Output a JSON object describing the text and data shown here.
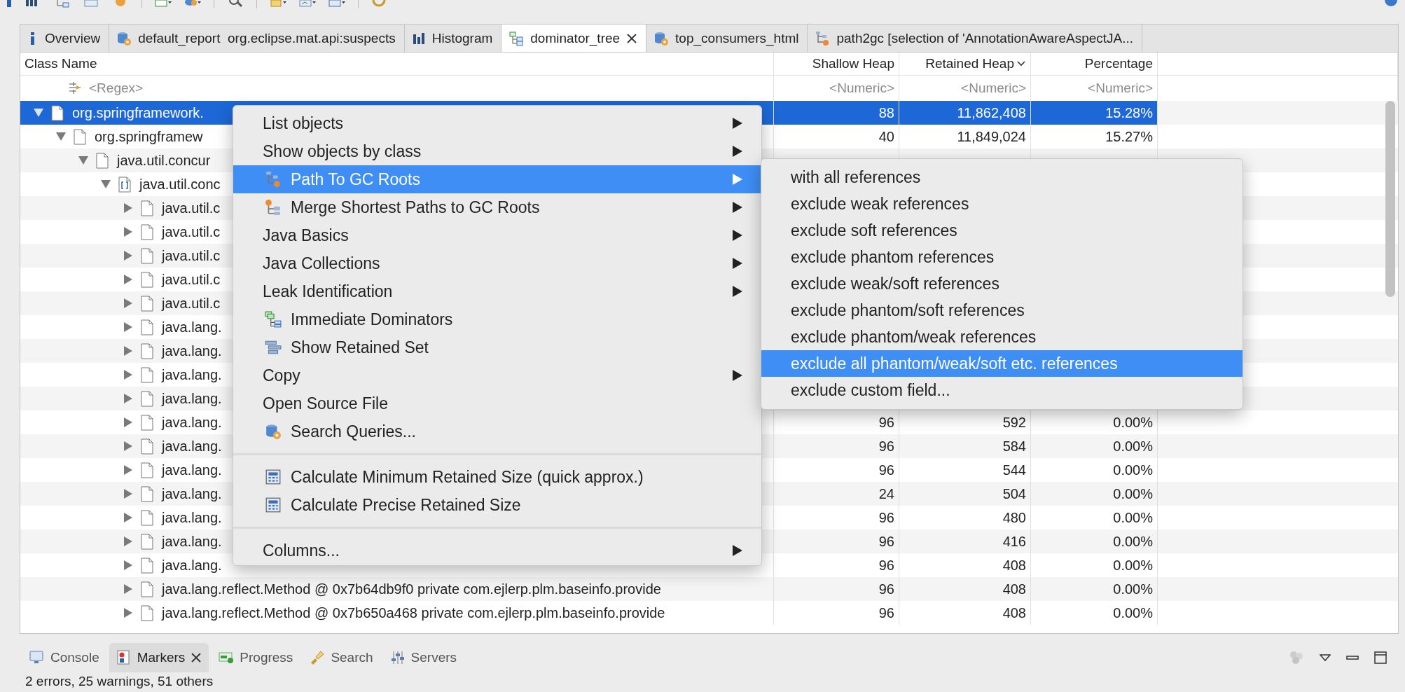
{
  "editor_tabs": [
    {
      "label": "Overview",
      "selected": false,
      "closable": false
    },
    {
      "label": "default_report  org.eclipse.mat.api:suspects",
      "selected": false,
      "closable": false
    },
    {
      "label": "Histogram",
      "selected": false,
      "closable": false
    },
    {
      "label": "dominator_tree",
      "selected": true,
      "closable": true
    },
    {
      "label": "top_consumers_html",
      "selected": false,
      "closable": false
    },
    {
      "label": "path2gc [selection of 'AnnotationAwareAspectJA...",
      "selected": false,
      "closable": false
    }
  ],
  "table": {
    "columns": [
      {
        "label": "Class Name",
        "sorted": false
      },
      {
        "label": "Shallow Heap",
        "sorted": false
      },
      {
        "label": "Retained Heap",
        "sorted": true
      },
      {
        "label": "Percentage",
        "sorted": false
      }
    ],
    "filters": [
      "<Regex>",
      "<Numeric>",
      "<Numeric>",
      "<Numeric>"
    ],
    "rows": [
      {
        "name": "org.springframework.",
        "kind": "object",
        "expanded": true,
        "selected": true,
        "shallow_heap": "88",
        "retained_heap": "11,862,408",
        "percentage": "15.28%",
        "children": [
          {
            "name": "org.springframew",
            "kind": "object",
            "expanded": true,
            "selected": false,
            "shallow_heap": "40",
            "retained_heap": "11,849,024",
            "percentage": "15.27%",
            "children": [
              {
                "name": "java.util.concur",
                "kind": "object",
                "expanded": true,
                "selected": false,
                "children": [
                  {
                    "name": "java.util.conc",
                    "kind": "array",
                    "expanded": true,
                    "selected": false,
                    "children": [
                      {
                        "name": "java.util.c",
                        "kind": "object",
                        "expanded": false,
                        "selected": false
                      },
                      {
                        "name": "java.util.c",
                        "kind": "object",
                        "expanded": false,
                        "selected": false
                      },
                      {
                        "name": "java.util.c",
                        "kind": "object",
                        "expanded": false,
                        "selected": false
                      },
                      {
                        "name": "java.util.c",
                        "kind": "object",
                        "expanded": false,
                        "selected": false
                      },
                      {
                        "name": "java.util.c",
                        "kind": "object",
                        "expanded": false,
                        "selected": false
                      },
                      {
                        "name": "java.lang.",
                        "kind": "object",
                        "expanded": false,
                        "selected": false
                      },
                      {
                        "name": "java.lang.",
                        "kind": "object",
                        "expanded": false,
                        "selected": false
                      },
                      {
                        "name": "java.lang.",
                        "kind": "object",
                        "expanded": false,
                        "selected": false
                      },
                      {
                        "name": "java.lang.",
                        "kind": "object",
                        "expanded": false,
                        "selected": false
                      },
                      {
                        "name": "java.lang.",
                        "kind": "object",
                        "expanded": false,
                        "selected": false,
                        "shallow_heap": "96",
                        "retained_heap": "592",
                        "percentage": "0.00%"
                      },
                      {
                        "name": "java.lang.",
                        "kind": "object",
                        "expanded": false,
                        "selected": false,
                        "shallow_heap": "96",
                        "retained_heap": "584",
                        "percentage": "0.00%"
                      },
                      {
                        "name": "java.lang.",
                        "kind": "object",
                        "expanded": false,
                        "selected": false,
                        "shallow_heap": "96",
                        "retained_heap": "544",
                        "percentage": "0.00%"
                      },
                      {
                        "name": "java.lang.",
                        "kind": "object",
                        "expanded": false,
                        "selected": false,
                        "shallow_heap": "24",
                        "retained_heap": "504",
                        "percentage": "0.00%"
                      },
                      {
                        "name": "java.lang.",
                        "kind": "object",
                        "expanded": false,
                        "selected": false,
                        "shallow_heap": "96",
                        "retained_heap": "480",
                        "percentage": "0.00%"
                      },
                      {
                        "name": "java.lang.",
                        "kind": "object",
                        "expanded": false,
                        "selected": false,
                        "shallow_heap": "96",
                        "retained_heap": "416",
                        "percentage": "0.00%"
                      },
                      {
                        "name": "java.lang.",
                        "kind": "object",
                        "expanded": false,
                        "selected": false,
                        "shallow_heap": "96",
                        "retained_heap": "408",
                        "percentage": "0.00%"
                      },
                      {
                        "name": "java.lang.reflect.Method @ 0x7b64db9f0  private  com.ejlerp.plm.baseinfo.provide",
                        "kind": "object",
                        "expanded": false,
                        "selected": false,
                        "shallow_heap": "96",
                        "retained_heap": "408",
                        "percentage": "0.00%"
                      },
                      {
                        "name": "java.lang.reflect.Method @ 0x7b650a468  private  com.ejlerp.plm.baseinfo.provide",
                        "kind": "object",
                        "expanded": false,
                        "selected": false,
                        "shallow_heap": "96",
                        "retained_heap": "408",
                        "percentage": "0.00%"
                      }
                    ]
                  }
                ]
              }
            ]
          }
        ]
      }
    ]
  },
  "context_menu": {
    "items": [
      {
        "kind": "item",
        "label": "List objects",
        "has_submenu": true,
        "selected": false
      },
      {
        "kind": "item",
        "label": "Show objects by class",
        "has_submenu": true,
        "selected": false
      },
      {
        "kind": "item",
        "label": "Path To GC Roots",
        "has_submenu": true,
        "selected": true
      },
      {
        "kind": "item",
        "label": "Merge Shortest Paths to GC Roots",
        "has_submenu": true,
        "selected": false
      },
      {
        "kind": "item",
        "label": "Java Basics",
        "has_submenu": true,
        "selected": false
      },
      {
        "kind": "item",
        "label": "Java Collections",
        "has_submenu": true,
        "selected": false
      },
      {
        "kind": "item",
        "label": "Leak Identification",
        "has_submenu": true,
        "selected": false
      },
      {
        "kind": "item",
        "label": "Immediate Dominators",
        "has_submenu": false,
        "selected": false
      },
      {
        "kind": "item",
        "label": "Show Retained Set",
        "has_submenu": false,
        "selected": false
      },
      {
        "kind": "item",
        "label": "Copy",
        "has_submenu": true,
        "selected": false
      },
      {
        "kind": "item",
        "label": "Open Source File",
        "has_submenu": false,
        "selected": false
      },
      {
        "kind": "item",
        "label": "Search Queries...",
        "has_submenu": false,
        "selected": false
      },
      {
        "kind": "separator"
      },
      {
        "kind": "item",
        "label": "Calculate Minimum Retained Size (quick approx.)",
        "has_submenu": false,
        "selected": false
      },
      {
        "kind": "item",
        "label": "Calculate Precise Retained Size",
        "has_submenu": false,
        "selected": false
      },
      {
        "kind": "separator"
      },
      {
        "kind": "item",
        "label": "Columns...",
        "has_submenu": true,
        "selected": false
      }
    ]
  },
  "submenu": {
    "items": [
      {
        "label": "with all references",
        "selected": false
      },
      {
        "label": "exclude weak references",
        "selected": false
      },
      {
        "label": "exclude soft references",
        "selected": false
      },
      {
        "label": "exclude phantom references",
        "selected": false
      },
      {
        "label": "exclude weak/soft references",
        "selected": false
      },
      {
        "label": "exclude phantom/soft references",
        "selected": false
      },
      {
        "label": "exclude phantom/weak references",
        "selected": false
      },
      {
        "label": "exclude all phantom/weak/soft etc. references",
        "selected": true
      },
      {
        "label": "exclude custom field...",
        "selected": false
      }
    ]
  },
  "bottom_panel": {
    "tabs": [
      {
        "label": "Console",
        "selected": false,
        "closable": false
      },
      {
        "label": "Markers",
        "selected": true,
        "closable": true
      },
      {
        "label": "Progress",
        "selected": false,
        "closable": false
      },
      {
        "label": "Search",
        "selected": false,
        "closable": false
      },
      {
        "label": "Servers",
        "selected": false,
        "closable": false
      }
    ],
    "status": "2 errors, 25 warnings, 51 others"
  }
}
